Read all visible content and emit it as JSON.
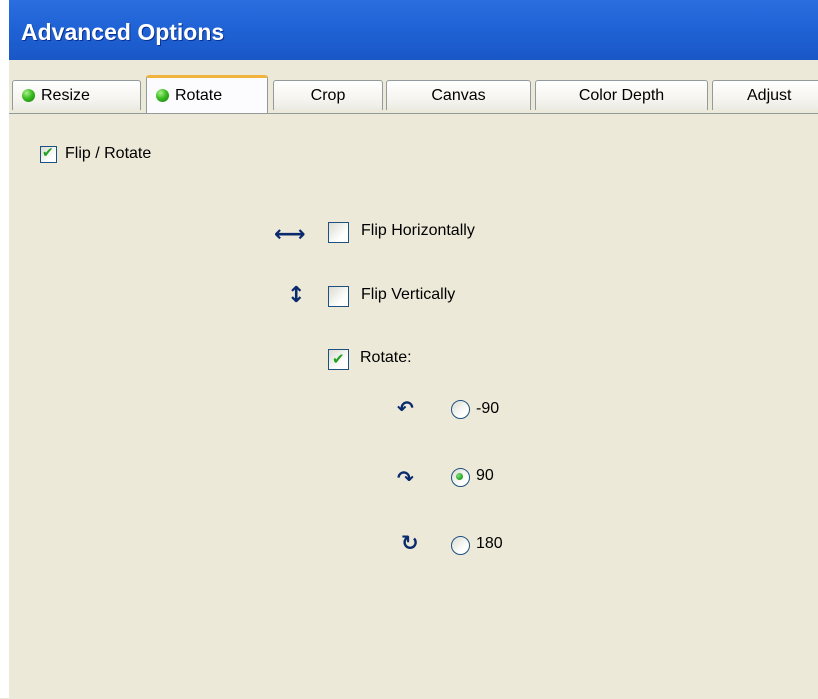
{
  "window": {
    "title": "Advanced Options"
  },
  "tabs": [
    {
      "label": "Resize",
      "status_icon": "green-dot-icon"
    },
    {
      "label": "Rotate",
      "status_icon": "green-dot-icon",
      "active": true
    },
    {
      "label": "Crop"
    },
    {
      "label": "Canvas"
    },
    {
      "label": "Color Depth"
    },
    {
      "label": "Adjust"
    }
  ],
  "panel": {
    "flip_rotate": {
      "label": "Flip / Rotate",
      "checked": true
    },
    "flip_horizontal": {
      "label": "Flip Horizontally",
      "checked": false,
      "icon": "horizontal-arrows-icon"
    },
    "flip_vertical": {
      "label": "Flip Vertically",
      "checked": false,
      "icon": "vertical-arrows-icon"
    },
    "rotate": {
      "label": "Rotate:",
      "checked": true
    },
    "rotate_options": [
      {
        "label": "-90",
        "selected": false,
        "icon": "rotate-left-icon"
      },
      {
        "label": "90",
        "selected": true,
        "icon": "rotate-right-icon"
      },
      {
        "label": "180",
        "selected": false,
        "icon": "rotate-180-icon"
      }
    ]
  },
  "colors": {
    "titlebar": "#1f63d6",
    "panel_bg": "#ece9d8",
    "active_tab_accent": "#f0b43c",
    "check_green": "#21a121"
  }
}
